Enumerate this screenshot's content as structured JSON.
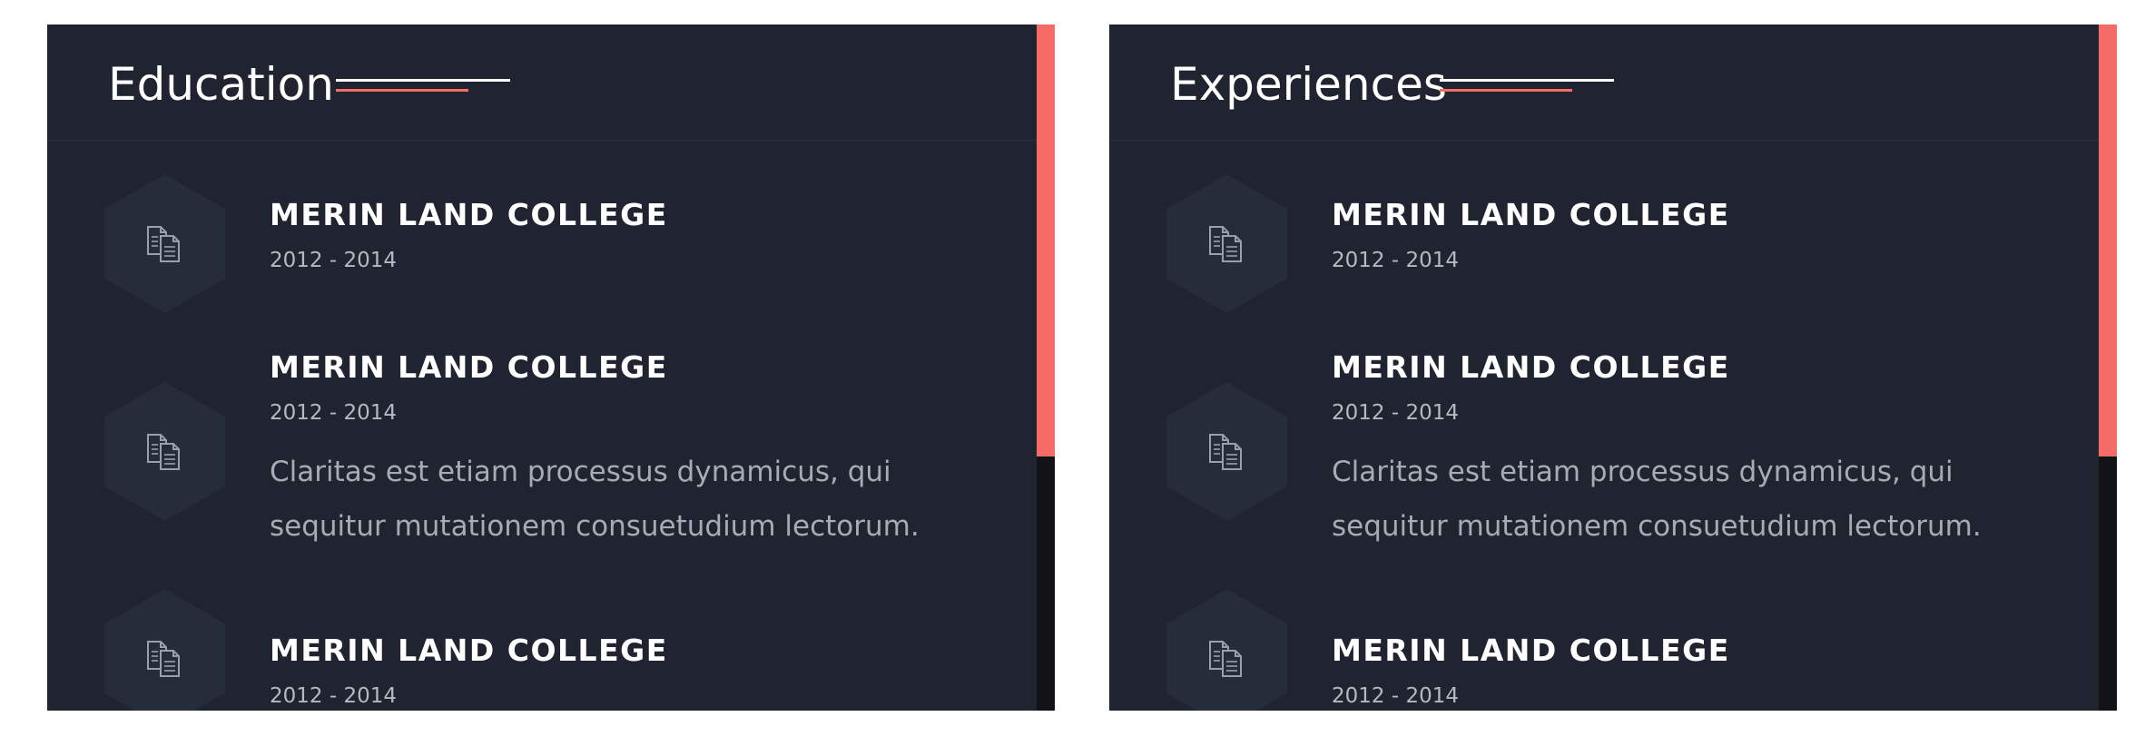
{
  "colors": {
    "panel_bg": "#1f2430",
    "hexagon": "#262d3a",
    "accent": "#f56b66",
    "scroll_track": "#111318",
    "title_text": "#ffffff",
    "meta_text": "#b5b9c1"
  },
  "education": {
    "title": "Education",
    "items": [
      {
        "icon": "document-copy-icon",
        "title": "MERIN LAND COLLEGE",
        "date": "2012 - 2014"
      },
      {
        "icon": "document-copy-icon",
        "title": "MERIN LAND COLLEGE",
        "date": "2012 - 2014",
        "description": "Claritas est etiam processus dynamicus, qui sequitur mutationem consuetudium lectorum."
      },
      {
        "icon": "document-copy-icon",
        "title": "MERIN LAND COLLEGE",
        "date": "2012 - 2014"
      }
    ]
  },
  "experiences": {
    "title": "Experiences",
    "items": [
      {
        "icon": "document-copy-icon",
        "title": "MERIN LAND COLLEGE",
        "date": "2012 - 2014"
      },
      {
        "icon": "document-copy-icon",
        "title": "MERIN LAND COLLEGE",
        "date": "2012 - 2014",
        "description": "Claritas est etiam processus dynamicus, qui sequitur mutationem consuetudium lectorum."
      },
      {
        "icon": "document-copy-icon",
        "title": "MERIN LAND COLLEGE",
        "date": "2012 - 2014"
      }
    ]
  }
}
